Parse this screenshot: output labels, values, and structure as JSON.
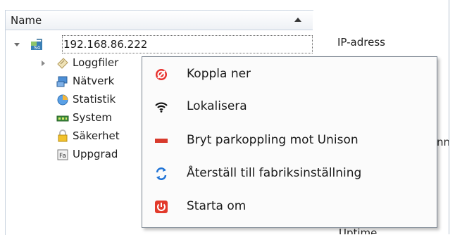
{
  "tree": {
    "column_header": "Name",
    "rows": [
      {
        "label": "192.168.86.222",
        "expanded": true,
        "icon": "device-icon"
      },
      {
        "label": "Loggfiler",
        "icon": "log-files-icon"
      },
      {
        "label": "Nätverk",
        "icon": "network-icon"
      },
      {
        "label": "Statistik",
        "icon": "statistics-icon"
      },
      {
        "label": "System",
        "icon": "system-icon"
      },
      {
        "label": "Säkerhet",
        "icon": "lock-icon"
      },
      {
        "label": "Uppgrad",
        "icon": "upgrade-icon"
      }
    ]
  },
  "right_panel": {
    "ip_label": "IP-adress",
    "partial_label": "nn",
    "bottom_partial": "Uptime"
  },
  "context_menu": {
    "items": [
      {
        "label": "Koppla ner",
        "icon": "disconnect-icon"
      },
      {
        "label": "Lokalisera",
        "icon": "wifi-icon"
      },
      {
        "label": "Bryt parkoppling mot Unison",
        "icon": "unpair-icon"
      },
      {
        "label": "Återställ till fabriksinställning",
        "icon": "factory-reset-icon"
      },
      {
        "label": "Starta om",
        "icon": "restart-icon"
      }
    ]
  },
  "colors": {
    "menu_border": "#7b8591",
    "disconnect_red": "#e8332f",
    "unpair_red": "#d83a2c",
    "reset_blue": "#1f73d6",
    "restart_red": "#e23a2b"
  }
}
